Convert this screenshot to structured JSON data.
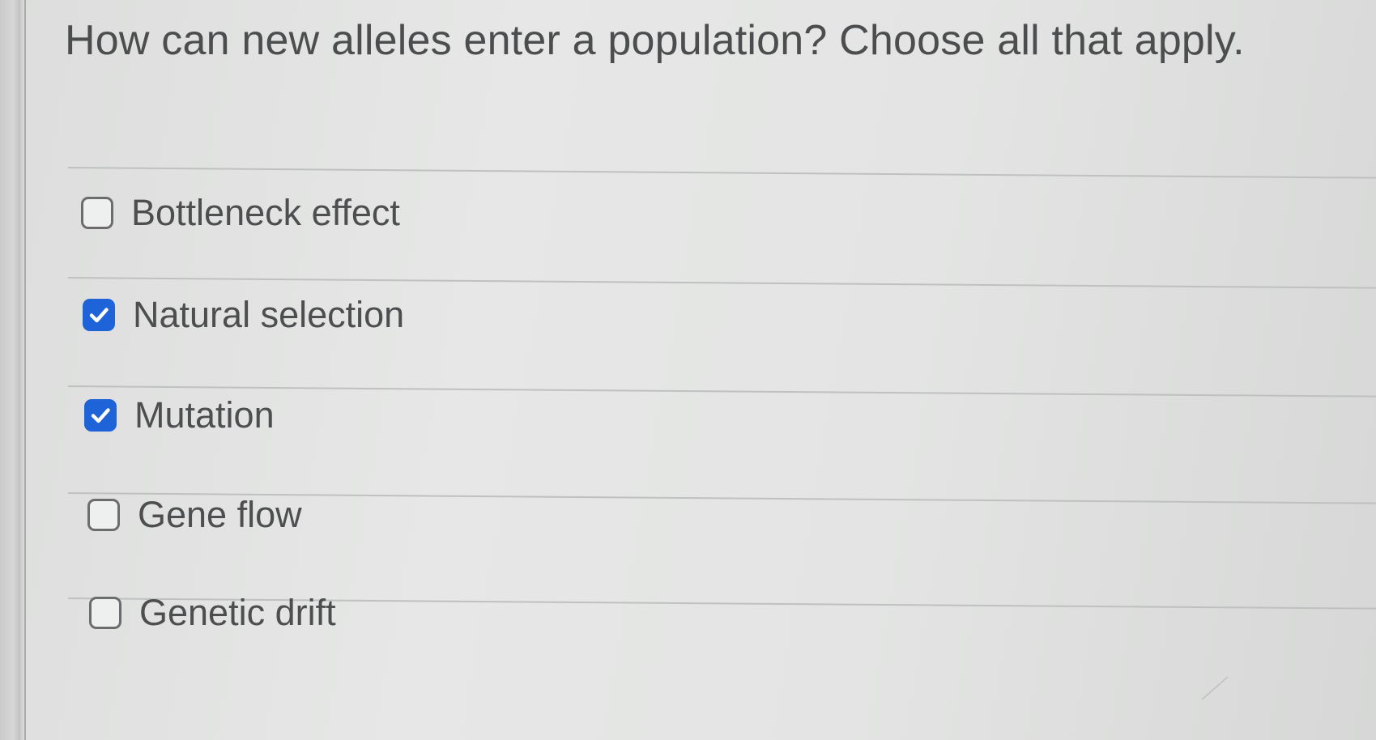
{
  "question": {
    "text": "How can new alleles enter a population? Choose all that apply."
  },
  "options": [
    {
      "label": "Bottleneck effect",
      "checked": false,
      "icon": "checkbox-unchecked-icon"
    },
    {
      "label": "Natural selection",
      "checked": true,
      "icon": "checkbox-checked-icon"
    },
    {
      "label": "Mutation",
      "checked": true,
      "icon": "checkbox-checked-icon"
    },
    {
      "label": "Gene flow",
      "checked": false,
      "icon": "checkbox-unchecked-icon"
    },
    {
      "label": "Genetic drift",
      "checked": false,
      "icon": "checkbox-unchecked-icon"
    }
  ],
  "colors": {
    "background": "#e3e4e3",
    "text": "#4b4d4e",
    "checkbox_checked": "#1f63d8",
    "checkbox_border": "#6a6c6d",
    "divider": "#bfc1c0"
  }
}
